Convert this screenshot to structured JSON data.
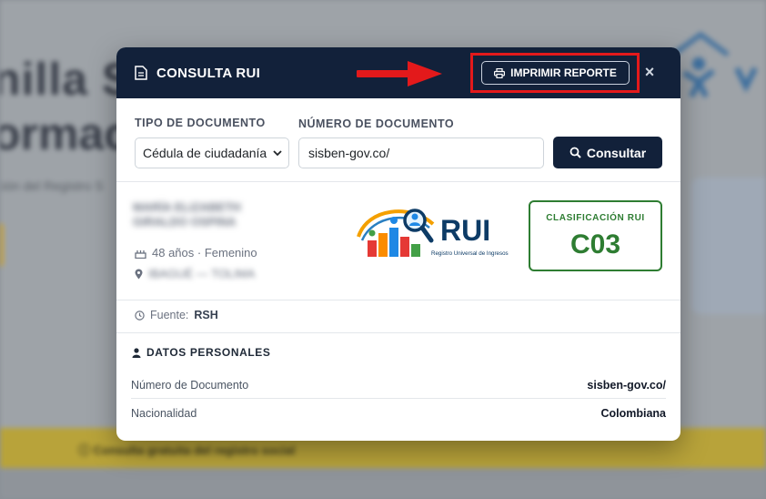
{
  "background": {
    "title_line1": "nilla S",
    "title_line2": "ormac",
    "subtitle": "ción del Registro S",
    "band_text": "ⓘ  Consulta gratuita del registro social"
  },
  "modal": {
    "title": "CONSULTA RUI",
    "print_label": "IMPRIMIR REPORTE",
    "close_label": "×"
  },
  "form": {
    "tipo_label": "TIPO DE DOCUMENTO",
    "tipo_value": "Cédula de ciudadanía",
    "numero_label": "NÚMERO DE DOCUMENTO",
    "numero_value": "sisben-gov.co/",
    "search_label": "Consultar"
  },
  "person": {
    "name_line1": "MARÍA ELIZABETH",
    "name_line2": "GIRALDO OSPINA",
    "age_gender": "48 años · Femenino",
    "location": "IBAGUÉ — TOLIMA"
  },
  "logo": {
    "text": "RUI",
    "tagline": "Registro Universal de Ingresos"
  },
  "classification": {
    "label": "CLASIFICACIÓN RUI",
    "value": "C03"
  },
  "source": {
    "label": "Fuente:",
    "value": "RSH"
  },
  "personal": {
    "title": "DATOS PERSONALES",
    "rows": [
      {
        "key": "Número de Documento",
        "value": "sisben-gov.co/"
      },
      {
        "key": "Nacionalidad",
        "value": "Colombiana"
      }
    ]
  },
  "colors": {
    "header": "#12213a",
    "accent_green": "#2e7d32",
    "highlight_red": "#e3191b"
  }
}
